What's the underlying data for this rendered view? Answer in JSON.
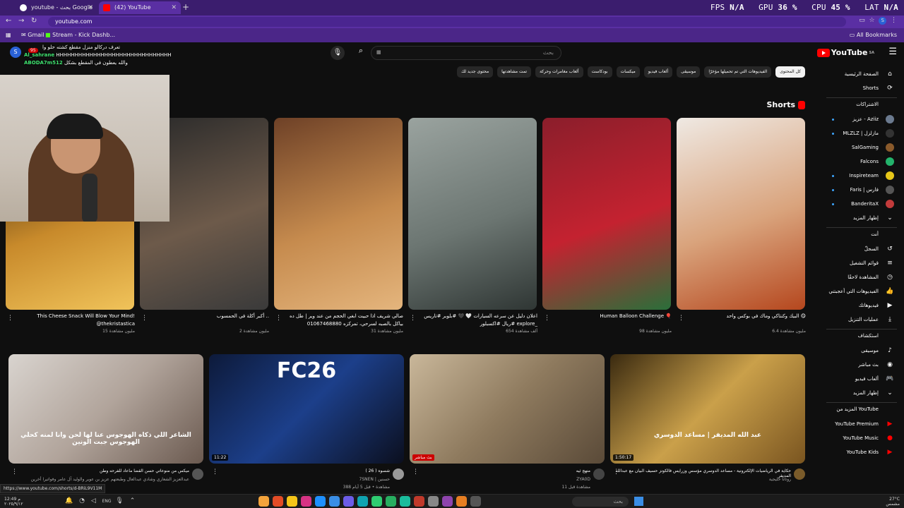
{
  "browser": {
    "tabs": [
      {
        "label": "youtube - بحث Google",
        "active": false
      },
      {
        "label": "(42) YouTube",
        "active": true
      }
    ],
    "url": "youtube.com",
    "bookmarks": [
      "Gmail",
      "Stream - Kick Dashb..."
    ],
    "all_bookmarks": "All Bookmarks",
    "profile_initial": "S"
  },
  "perf": {
    "fps_label": "FPS",
    "fps": "N/A",
    "gpu_label": "GPU",
    "gpu": "36 %",
    "cpu_label": "CPU",
    "cpu": "45 %",
    "lat_label": "LAT",
    "lat": "N/A"
  },
  "youtube": {
    "logo_text": "YouTube",
    "logo_region": "SA",
    "search_placeholder": "بحث",
    "chips": [
      "كل المحتوى",
      "الفيديوهات التي تم تحميلها مؤخرًا",
      "موسيقى",
      "ألعاب فيديو",
      "ميكسات",
      "بودكاست",
      "ألعاب مغامرات وحركة",
      "تمت مشاهدتها",
      "محتوى جديد لك"
    ],
    "sidebar": {
      "main": [
        {
          "label": "الصفحة الرئيسية",
          "icon": "home-icon"
        },
        {
          "label": "Shorts",
          "icon": "shorts-icon"
        }
      ],
      "subs_header": "الاشتراكات",
      "subs": [
        {
          "label": "عزيز - Aziiz",
          "color": "#6b7a8f",
          "dot": true
        },
        {
          "label": "MLZLZ | مازلزل",
          "color": "#333333",
          "dot": true
        },
        {
          "label": "SalGaming",
          "color": "#8a5a2b",
          "dot": false
        },
        {
          "label": "Falcons",
          "color": "#23b36b",
          "dot": false
        },
        {
          "label": "Inspireteam",
          "color": "#e6c619",
          "dot": true
        },
        {
          "label": "Faris | فارس",
          "color": "#555555",
          "dot": true
        },
        {
          "label": "BanderitaX",
          "color": "#c23b3b",
          "dot": true
        },
        {
          "label": "إظهار المزيد",
          "icon": "chevron-down-icon"
        }
      ],
      "you_header": "أنت",
      "you": [
        {
          "label": "السجلّ",
          "icon": "history-icon"
        },
        {
          "label": "قوائم التشغيل",
          "icon": "playlist-icon"
        },
        {
          "label": "المشاهدة لاحقًا",
          "icon": "clock-icon"
        },
        {
          "label": "الفيديوهات التي أعجبتني",
          "icon": "like-icon"
        },
        {
          "label": "فيديوهاتك",
          "icon": "video-icon"
        },
        {
          "label": "عمليات التنزيل",
          "icon": "download-icon"
        }
      ],
      "explore_header": "استكشاف",
      "explore": [
        {
          "label": "موسيقى",
          "icon": "music-icon"
        },
        {
          "label": "بث مباشر",
          "icon": "live-icon"
        },
        {
          "label": "ألعاب فيديو",
          "icon": "gaming-icon"
        },
        {
          "label": "إظهار المزيد",
          "icon": "chevron-down-icon"
        }
      ],
      "more_header": "المزيد من YouTube",
      "more": [
        {
          "label": "YouTube Premium",
          "icon": "premium-icon"
        },
        {
          "label": "YouTube Music",
          "icon": "yt-music-icon"
        },
        {
          "label": "YouTube Kids",
          "icon": "yt-kids-icon"
        }
      ]
    },
    "shorts_header": "Shorts",
    "shorts": [
      {
        "title": "البيك وكنتاكي وماك في بوكس واحد 😋",
        "meta": "6.4 مليون مشاهدة",
        "colors": [
          "#efe9e3",
          "#d9a37c",
          "#b5471e"
        ]
      },
      {
        "title": "Human Balloon Challenge 🎈",
        "meta": "98 مليون مشاهدة",
        "colors": [
          "#8b1e2b",
          "#c42230",
          "#2a6f3a"
        ]
      },
      {
        "title": "اعلان دليل عن سرعه السيارات 🤍 🖤 #بلوبر #تاريس #ريال #اكسبلور explore_",
        "meta": "654 ألف مشاهدة",
        "colors": [
          "#9aa39f",
          "#6c7672",
          "#2f3634"
        ]
      },
      {
        "title": "صالي شريف اذا حبيت ابغي الحجم من عند وير | طل ده بياكل بالصبه لسرحي، تمركزه 01067468880",
        "meta": "31 مليون مشاهدة",
        "colors": [
          "#6e4127",
          "#c68b4e",
          "#e4b57d"
        ]
      },
      {
        "title": "أكبر أكلة في الحمسوب ..",
        "meta": "2 مليون مشاهدة",
        "colors": [
          "#2a2a2a",
          "#6d5a4a",
          "#3a3a3a"
        ]
      },
      {
        "title": "This Cheese Snack Will Blow Your Mind! @thekristastica",
        "meta": "15 مليون مشاهدة",
        "colors": [
          "#1b1208",
          "#c88a2b",
          "#f0c35a"
        ]
      }
    ],
    "videos": [
      {
        "title": "حكاية في الرياضيات الإلكترونية - مساعد الدوسري مؤسس وزرايس فالكونز حسيف البيان مع عبدالله المديفر",
        "channel": "روتانا خليجية",
        "meta": "",
        "duration": "1:50:17",
        "avcolor": "#7a5b2a",
        "colors": [
          "#3a2a10",
          "#caa04a",
          "#7a5520"
        ],
        "overlay": "عبد الله المديفر  |  مساعد الدوسري"
      },
      {
        "title": "منهج ثيه",
        "channel": "ZYA0D",
        "meta": "11 مشاهدة قبل",
        "duration": "بث مباشر",
        "avcolor": "#444444",
        "colors": [
          "#c9b79a",
          "#8e7a5e",
          "#5a4a38"
        ],
        "overlay": ""
      },
      {
        "title": "شسوه ( 26 )",
        "channel": "7SNEN | حسنين",
        "meta": "388 مشاهدة • قبل 5 أيام",
        "duration": "11:22",
        "avcolor": "#999999",
        "colors": [
          "#0d1a3a",
          "#1c3f8a",
          "#0b0f1e"
        ],
        "overlay": "FC26"
      },
      {
        "title": "ميكس من منوعاتي حسن القضا ماعاد للفرحه وطن",
        "channel": "عبدالعزيز الشعاري وشادي عبدالعال وطبعتهم عزيز بن عوير والوليد آل عامر وفواتيرا أخرين",
        "meta": "",
        "duration": "",
        "avcolor": "#555555",
        "colors": [
          "#d9d4cf",
          "#b1a49b",
          "#6b5a50"
        ],
        "overlay": "الشاعر اللي ذكاه الهوجوس عنا لها لحن  وانا لمنه كحلي الهوجوس جبت الونين"
      }
    ]
  },
  "stream": {
    "chat": [
      {
        "user": "",
        "text": "تعرف دركالو منزل مقطع كشته حلو وا"
      },
      {
        "user": "Al_sahrane",
        "text": "HHHHHHHHHHHHHHHHHHHHHHHHHHHHHHH"
      },
      {
        "user": "ABODA7m512",
        "text": "والله يعطون في المقطع بشكل"
      }
    ],
    "badge_count": "95"
  },
  "status_url": "https://www.youtube.com/shorts/d-BRiL9V11M",
  "taskbar": {
    "date": "٢٠٢٥/٩/١٢",
    "time": "م 12:49",
    "lang": "ENG",
    "search": "بحث",
    "weather_temp": "27°C",
    "weather_desc": "مشمس"
  }
}
